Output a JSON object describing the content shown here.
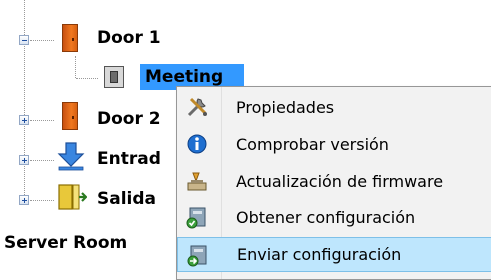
{
  "tree": {
    "items": [
      {
        "label": "Door 1",
        "expander": "minus",
        "icon": "door-icon"
      },
      {
        "label": "Meeting",
        "icon": "card-reader-icon",
        "selected": true
      },
      {
        "label": "Door 2",
        "expander": "plus",
        "icon": "door-icon"
      },
      {
        "label": "Entrad",
        "expander": "plus",
        "icon": "down-arrow-icon"
      },
      {
        "label": "Salida",
        "expander": "plus",
        "icon": "exit-icon"
      }
    ],
    "group_label": "Server Room",
    "selection_color": "#3399ff"
  },
  "context_menu": {
    "items": [
      {
        "label": "Propiedades",
        "icon": "tools-icon"
      },
      {
        "label": "Comprobar versión",
        "icon": "info-icon"
      },
      {
        "label": "Actualización de firmware",
        "icon": "firmware-update-icon"
      },
      {
        "label": "Obtener configuración",
        "icon": "get-config-icon"
      },
      {
        "label": "Enviar configuración",
        "icon": "send-config-icon",
        "hover": true
      }
    ],
    "hover_color": "#bee6fd"
  }
}
